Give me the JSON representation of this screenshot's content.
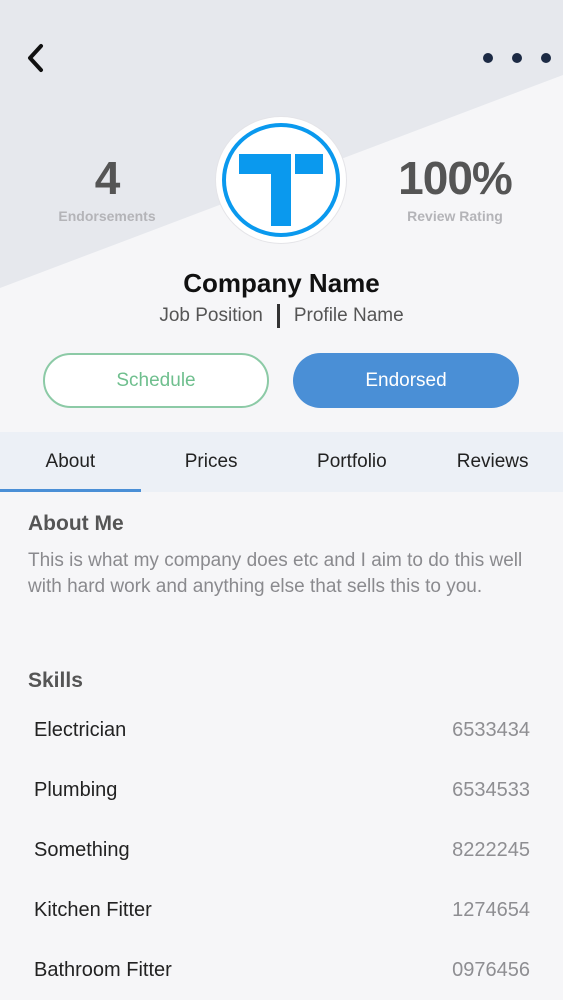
{
  "header": {
    "back_icon": "chevron-left-icon",
    "more_icon": "more-horizontal-icon"
  },
  "stats": {
    "endorsements_value": "4",
    "endorsements_label": "Endorsements",
    "rating_value": "100%",
    "rating_label": "Review Rating"
  },
  "profile": {
    "company_name": "Company Name",
    "job_position": "Job Position",
    "profile_name": "Profile Name",
    "logo_icon": "company-logo",
    "logo_color": "#0a99ee"
  },
  "actions": {
    "schedule_label": "Schedule",
    "endorsed_label": "Endorsed"
  },
  "tabs": [
    {
      "label": "About",
      "active": true
    },
    {
      "label": "Prices",
      "active": false
    },
    {
      "label": "Portfolio",
      "active": false
    },
    {
      "label": "Reviews",
      "active": false
    }
  ],
  "about": {
    "title": "About Me",
    "text": "This is what my company does etc and I aim to do this well with hard work and anything else that sells this to you."
  },
  "skills": {
    "title": "Skills",
    "items": [
      {
        "name": "Electrician",
        "value": "6533434"
      },
      {
        "name": "Plumbing",
        "value": "6534533"
      },
      {
        "name": "Something",
        "value": "8222245"
      },
      {
        "name": "Kitchen Fitter",
        "value": "1274654"
      },
      {
        "name": "Bathroom Fitter",
        "value": "0976456"
      }
    ]
  },
  "colors": {
    "accent": "#4a8fd6",
    "schedule_border": "#8ccaa6"
  }
}
